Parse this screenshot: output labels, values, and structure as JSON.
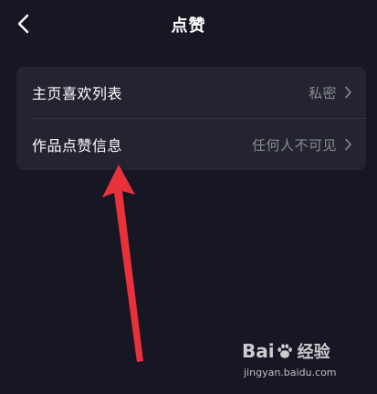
{
  "header": {
    "title": "点赞",
    "back_icon": "chevron-left-icon"
  },
  "settings": [
    {
      "label": "主页喜欢列表",
      "value": "私密",
      "icon": "chevron-right-icon"
    },
    {
      "label": "作品点赞信息",
      "value": "任何人不可见",
      "icon": "chevron-right-icon"
    }
  ],
  "annotation": {
    "arrow_color": "#e8313a"
  },
  "watermark": {
    "brand_part1": "Bai",
    "brand_part2": "经验",
    "url": "jingyan.baidu.com"
  },
  "colors": {
    "background": "#161722",
    "card": "#232430",
    "text_primary": "#ffffff",
    "text_secondary": "#8a8b92"
  }
}
